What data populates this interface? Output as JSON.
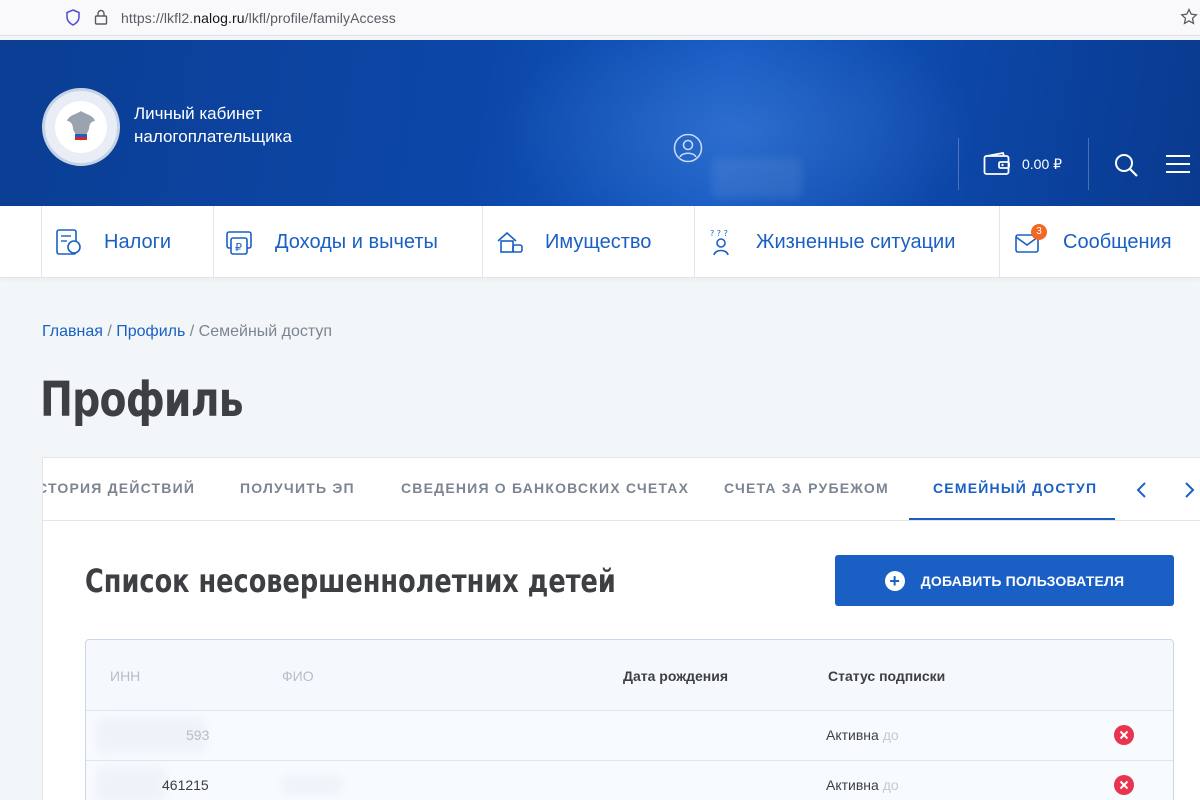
{
  "browser": {
    "url_prefix": "https://lkfl2.",
    "url_host": "nalog.ru",
    "url_path": "/lkfl/profile/familyAccess"
  },
  "header": {
    "brand_line1": "Личный кабинет",
    "brand_line2": "налогоплательщика",
    "balance": "0.00 ₽"
  },
  "nav": {
    "items": [
      {
        "label": "Налоги",
        "icon": "tax-icon"
      },
      {
        "label": "Доходы и вычеты",
        "icon": "income-icon"
      },
      {
        "label": "Имущество",
        "icon": "property-icon"
      },
      {
        "label": "Жизненные ситуации",
        "icon": "life-situations-icon"
      },
      {
        "label": "Сообщения",
        "icon": "messages-icon"
      }
    ],
    "messages_badge": "3"
  },
  "breadcrumb": {
    "home": "Главная",
    "profile": "Профиль",
    "current": "Семейный доступ"
  },
  "page_title": "Профиль",
  "tabs": {
    "items": [
      "СТОРИЯ ДЕЙСТВИЙ",
      "ПОЛУЧИТЬ ЭП",
      "СВЕДЕНИЯ О БАНКОВСКИХ СЧЕТАХ",
      "СЧЕТА ЗА РУБЕЖОМ",
      "СЕМЕЙНЫЙ ДОСТУП"
    ],
    "active": "СЕМЕЙНЫЙ ДОСТУП"
  },
  "section": {
    "title": "Список несовершеннолетних детей",
    "add_button": "ДОБАВИТЬ ПОЛЬЗОВАТЕЛЯ"
  },
  "table": {
    "columns": [
      "ИНН",
      "ФИО",
      "Дата рождения",
      "Статус подписки"
    ],
    "rows": [
      {
        "inn": "593",
        "status": "Активна",
        "status_fade": "до"
      },
      {
        "inn": "461215",
        "status": "Активна",
        "status_fade": "до"
      }
    ]
  },
  "colors": {
    "accent": "#1a60c4",
    "header_blue": "#0c47a8",
    "danger": "#e8344e",
    "badge_orange": "#f26722"
  }
}
